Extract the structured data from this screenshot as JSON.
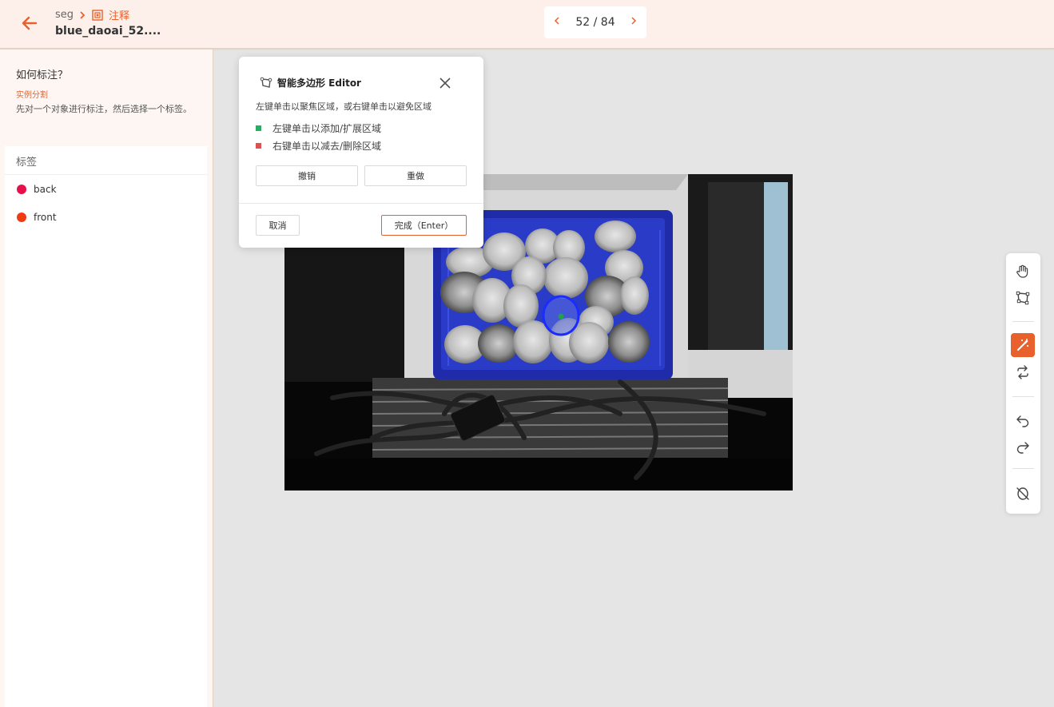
{
  "header": {
    "breadcrumb_project": "seg",
    "breadcrumb_current": "注释",
    "filename": "blue_daoai_52....",
    "pager": {
      "current_of_total": "52 / 84",
      "prev": "‹",
      "next": "›"
    }
  },
  "sidebar": {
    "howto_title": "如何标注？",
    "howto_type": "实例分割",
    "howto_desc": "先对一个对象进行标注，然后选择一个标签。",
    "labels_title": "标签",
    "labels": [
      {
        "name": "back",
        "color": "#e8104a"
      },
      {
        "name": "front",
        "color": "#f03a10"
      }
    ]
  },
  "editor": {
    "title": "智能多边形 Editor",
    "hint": "左键单击以聚焦区域，或右键单击以避免区域",
    "legend_add": "左键单击以添加/扩展区域",
    "legend_remove": "右键单击以减去/删除区域",
    "legend_add_color": "#27ae60",
    "legend_remove_color": "#e05050",
    "undo_label": "撤销",
    "redo_label": "重做",
    "cancel_label": "取消",
    "finish_label": "完成（Enter）"
  },
  "toolbar": {
    "tools": [
      "hand-icon",
      "polygon-icon",
      "magic-wand-icon",
      "swap-icon",
      "undo-icon",
      "redo-icon",
      "hide-icon"
    ],
    "active_tool": "magic-wand-icon",
    "accent": "#e8612c"
  }
}
